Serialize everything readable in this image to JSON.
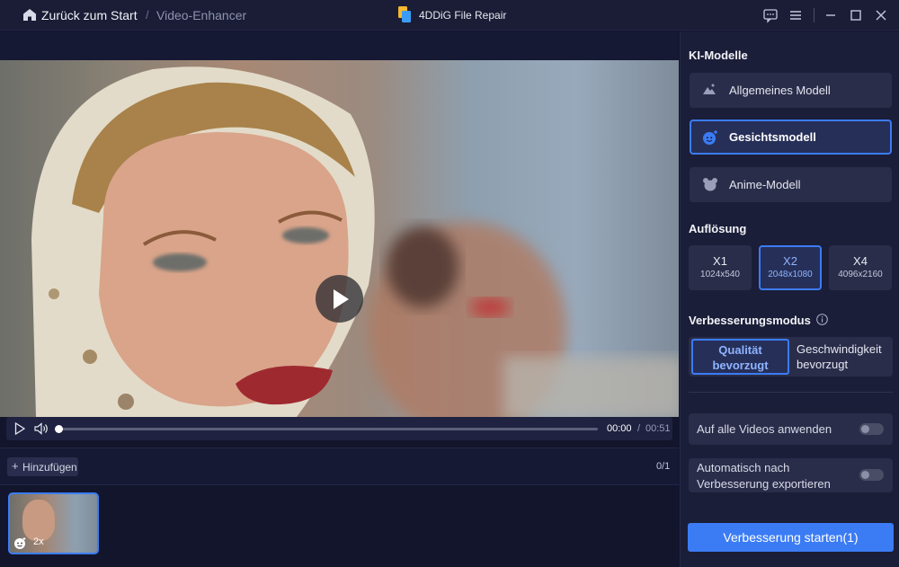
{
  "titlebar": {
    "back_label": "Zurück zum Start",
    "separator": "/",
    "breadcrumb": "Video-Enhancer",
    "app_name": "4DDiG File Repair"
  },
  "player": {
    "time_current": "00:00",
    "time_separator": "/",
    "time_total": "00:51",
    "progress": 0
  },
  "list": {
    "add_label": "Hinzufügen",
    "plus": "+",
    "count": "0/1",
    "thumbnail_scale": "2x"
  },
  "panel": {
    "models_title": "KI-Modelle",
    "models": [
      {
        "label": "Allgemeines Modell",
        "icon": "landscape-icon",
        "selected": false
      },
      {
        "label": "Gesichtsmodell",
        "icon": "face-icon",
        "selected": true
      },
      {
        "label": "Anime-Modell",
        "icon": "anime-icon",
        "selected": false
      }
    ],
    "resolution_title": "Auflösung",
    "resolutions": [
      {
        "label": "X1",
        "size": "1024x540",
        "selected": false
      },
      {
        "label": "X2",
        "size": "2048x1080",
        "selected": true
      },
      {
        "label": "X4",
        "size": "4096x2160",
        "selected": false
      }
    ],
    "mode_title": "Verbesserungsmodus",
    "modes": [
      {
        "line1": "Qualität",
        "line2": "bevorzugt",
        "selected": true
      },
      {
        "line1": "Geschwindigkeit",
        "line2": "bevorzugt",
        "selected": false
      }
    ],
    "apply_all_label": "Auf alle Videos anwenden",
    "auto_export_line1": "Automatisch nach",
    "auto_export_line2": "Verbesserung exportieren",
    "start_label": "Verbesserung starten(1)"
  },
  "colors": {
    "accent": "#3b7cf5",
    "background": "#12152b",
    "panel": "#1b1e38"
  }
}
